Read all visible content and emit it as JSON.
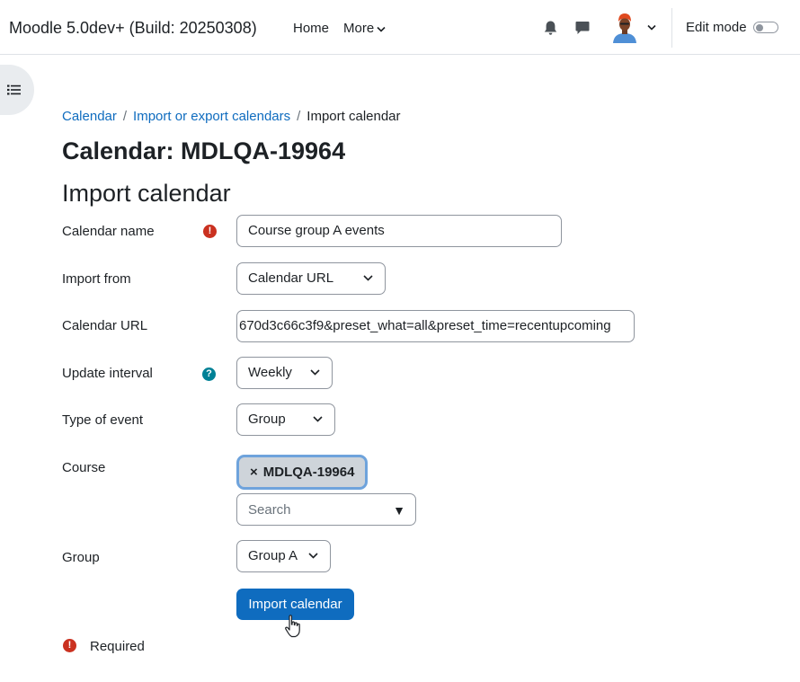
{
  "navbar": {
    "site_name": "Moodle 5.0dev+ (Build: 20250308)",
    "links": [
      {
        "label": "Home"
      },
      {
        "label": "More"
      }
    ],
    "icons": {
      "notifications": "bell-icon",
      "messages": "chat-bubble-icon"
    },
    "edit_mode_label": "Edit mode",
    "edit_mode_on": false
  },
  "breadcrumb": {
    "items": [
      {
        "label": "Calendar"
      },
      {
        "label": "Import or export calendars"
      },
      {
        "label": "Import calendar"
      }
    ],
    "separator": "/"
  },
  "page": {
    "title": "Calendar: MDLQA-19964",
    "section_title": "Import calendar"
  },
  "form": {
    "calendar_name": {
      "label": "Calendar name",
      "value": "Course group A events",
      "required": true
    },
    "import_from": {
      "label": "Import from",
      "value": "Calendar URL"
    },
    "calendar_url": {
      "label": "Calendar URL",
      "value": "670d3c66c3f9&preset_what=all&preset_time=recentupcoming"
    },
    "update_interval": {
      "label": "Update interval",
      "value": "Weekly",
      "help": "?"
    },
    "type_of_event": {
      "label": "Type of event",
      "value": "Group"
    },
    "course": {
      "label": "Course",
      "selected": "MDLQA-19964",
      "remove_glyph": "×",
      "search_placeholder": "Search",
      "dropdown_glyph": "▼"
    },
    "group": {
      "label": "Group",
      "value": "Group A"
    },
    "submit_label": "Import calendar",
    "required_note": "Required",
    "required_glyph": "!"
  },
  "colors": {
    "primary": "#0f6cbf",
    "required": "#ca3120",
    "help": "#008196",
    "tag_border": "#6ea3dc"
  }
}
